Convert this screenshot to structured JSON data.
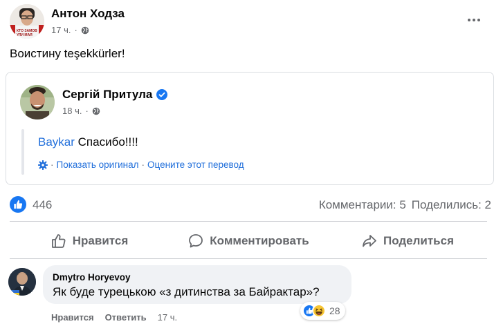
{
  "post": {
    "author": "Антон Ходза",
    "time": "17 ч.",
    "text": "Воистину teşekkürler!",
    "avatar_caption": "КТО ЗАМОВ",
    "avatar_caption_2": "УЛИ МАЯ"
  },
  "shared": {
    "author": "Сергій Притула",
    "time": "18 ч.",
    "mention": "Baykar",
    "text": " Спасибо!!!!",
    "show_original": "Показать оригинал",
    "separator": "·",
    "rate_translation": "Оцените этот перевод"
  },
  "stats": {
    "likes": "446",
    "comments": "Комментарии: 5",
    "shares": "Поделились: 2"
  },
  "actions": {
    "like": "Нравится",
    "comment": "Комментировать",
    "share": "Поделиться"
  },
  "comment": {
    "author": "Dmytro Horyevoy",
    "text": "Як буде турецькою «з дитинства за Байрактар»?",
    "reaction_count": "28",
    "like_action": "Нравится",
    "reply_action": "Ответить",
    "time": "17 ч."
  },
  "icons": [
    "globe-icon",
    "more-icon",
    "verified-icon",
    "gear-icon",
    "like-icon",
    "comment-icon",
    "share-icon",
    "haha-icon"
  ],
  "colors": {
    "link": "#216fdb",
    "brand": "#1877f2",
    "muted": "#65676b"
  }
}
